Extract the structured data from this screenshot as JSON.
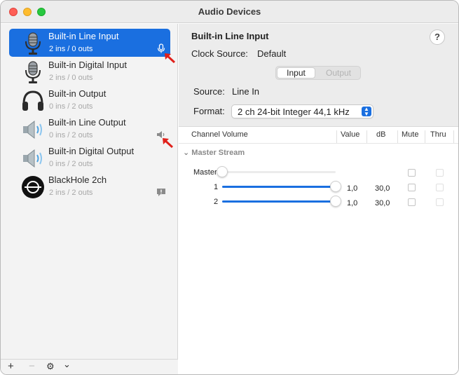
{
  "window": {
    "title": "Audio Devices"
  },
  "devices": [
    {
      "name": "Built-in Line Input",
      "io": "2 ins / 0 outs",
      "icon": "microphone-icon",
      "badge": "microphone-badge-icon",
      "selected": true
    },
    {
      "name": "Built-in Digital Input",
      "io": "2 ins / 0 outs",
      "icon": "microphone-icon"
    },
    {
      "name": "Built-in Output",
      "io": "0 ins / 2 outs",
      "icon": "headphones-icon"
    },
    {
      "name": "Built-in Line Output",
      "io": "0 ins / 2 outs",
      "icon": "speaker-icon",
      "badge": "speaker-badge-icon"
    },
    {
      "name": "Built-in Digital Output",
      "io": "0 ins / 2 outs",
      "icon": "speaker-icon"
    },
    {
      "name": "BlackHole 2ch",
      "io": "2 ins / 2 outs",
      "icon": "blackhole-icon",
      "badge": "message-badge-icon"
    }
  ],
  "sidebar_footer": {
    "add": "+",
    "remove": "−",
    "action": "⚙",
    "menu": "⌄"
  },
  "detail": {
    "device_name": "Built-in Line Input",
    "clock_label": "Clock Source:",
    "clock_value": "Default",
    "help": "?",
    "tabs": [
      "Input",
      "Output"
    ],
    "active_tab": "Input",
    "source_label": "Source:",
    "source_value": "Line In",
    "format_label": "Format:",
    "format_value": "2 ch 24-bit Integer 44,1 kHz"
  },
  "table": {
    "headers": [
      "Channel Volume",
      "Value",
      "dB",
      "Mute",
      "Thru"
    ],
    "group": "Master Stream",
    "rows": [
      {
        "label": "Master",
        "level": 0.0,
        "value": "",
        "db": "",
        "enabled": false
      },
      {
        "label": "1",
        "level": 1.0,
        "value": "1,0",
        "db": "30,0",
        "enabled": true
      },
      {
        "label": "2",
        "level": 1.0,
        "value": "1,0",
        "db": "30,0",
        "enabled": true
      }
    ]
  },
  "colors": {
    "accent": "#1a6fe0",
    "annotation_arrow": "#e0201a"
  }
}
